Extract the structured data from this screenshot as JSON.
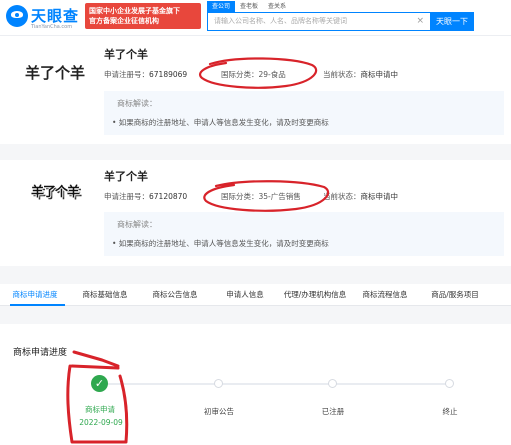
{
  "header": {
    "logo_name": "天眼查",
    "logo_sub": "TianYanCha.com",
    "banner_line1": "国家中小企业发展子基金旗下",
    "banner_line2": "官方备案企业征信机构",
    "search_tabs": [
      "查公司",
      "查老板",
      "查关系"
    ],
    "search_placeholder": "请输入公司名称、人名、品牌名称等关键词",
    "search_clear_icon": "close-icon",
    "search_button": "天眼一下"
  },
  "trademarks": [
    {
      "image_text": "羊了个羊",
      "name": "羊了个羊",
      "reg_label": "申请注册号：",
      "reg_no": "67189069",
      "class_label": "国际分类：",
      "class_value": "29-食品",
      "status_label": "当前状态：",
      "status_value": "商标申请中",
      "explain_title": "商标解读：",
      "explain_text": "• 如果商标的注册地址、申请人等信息发生变化，请及时变更商标"
    },
    {
      "image_text": "羊了个羊",
      "name": "羊了个羊",
      "reg_label": "申请注册号：",
      "reg_no": "67120870",
      "class_label": "国际分类：",
      "class_value": "35-广告销售",
      "status_label": "当前状态：",
      "status_value": "商标申请中",
      "explain_title": "商标解读：",
      "explain_text": "• 如果商标的注册地址、申请人等信息发生变化，请及时变更商标"
    }
  ],
  "tabs": [
    "商标申请进度",
    "商标基础信息",
    "商标公告信息",
    "申请人信息",
    "代理/办理机构信息",
    "商标流程信息",
    "商品/服务项目"
  ],
  "active_tab": 0,
  "progress": {
    "title": "商标申请进度",
    "steps": [
      {
        "label": "商标申请",
        "date": "2022-09-09",
        "done": true
      },
      {
        "label": "初审公告",
        "date": "",
        "done": false
      },
      {
        "label": "已注册",
        "date": "",
        "done": false
      },
      {
        "label": "终止",
        "date": "",
        "done": false
      }
    ]
  },
  "colors": {
    "brand": "#0084ff",
    "banner": "#e8473c",
    "annotation": "#d8232a",
    "done": "#2fa84f"
  }
}
